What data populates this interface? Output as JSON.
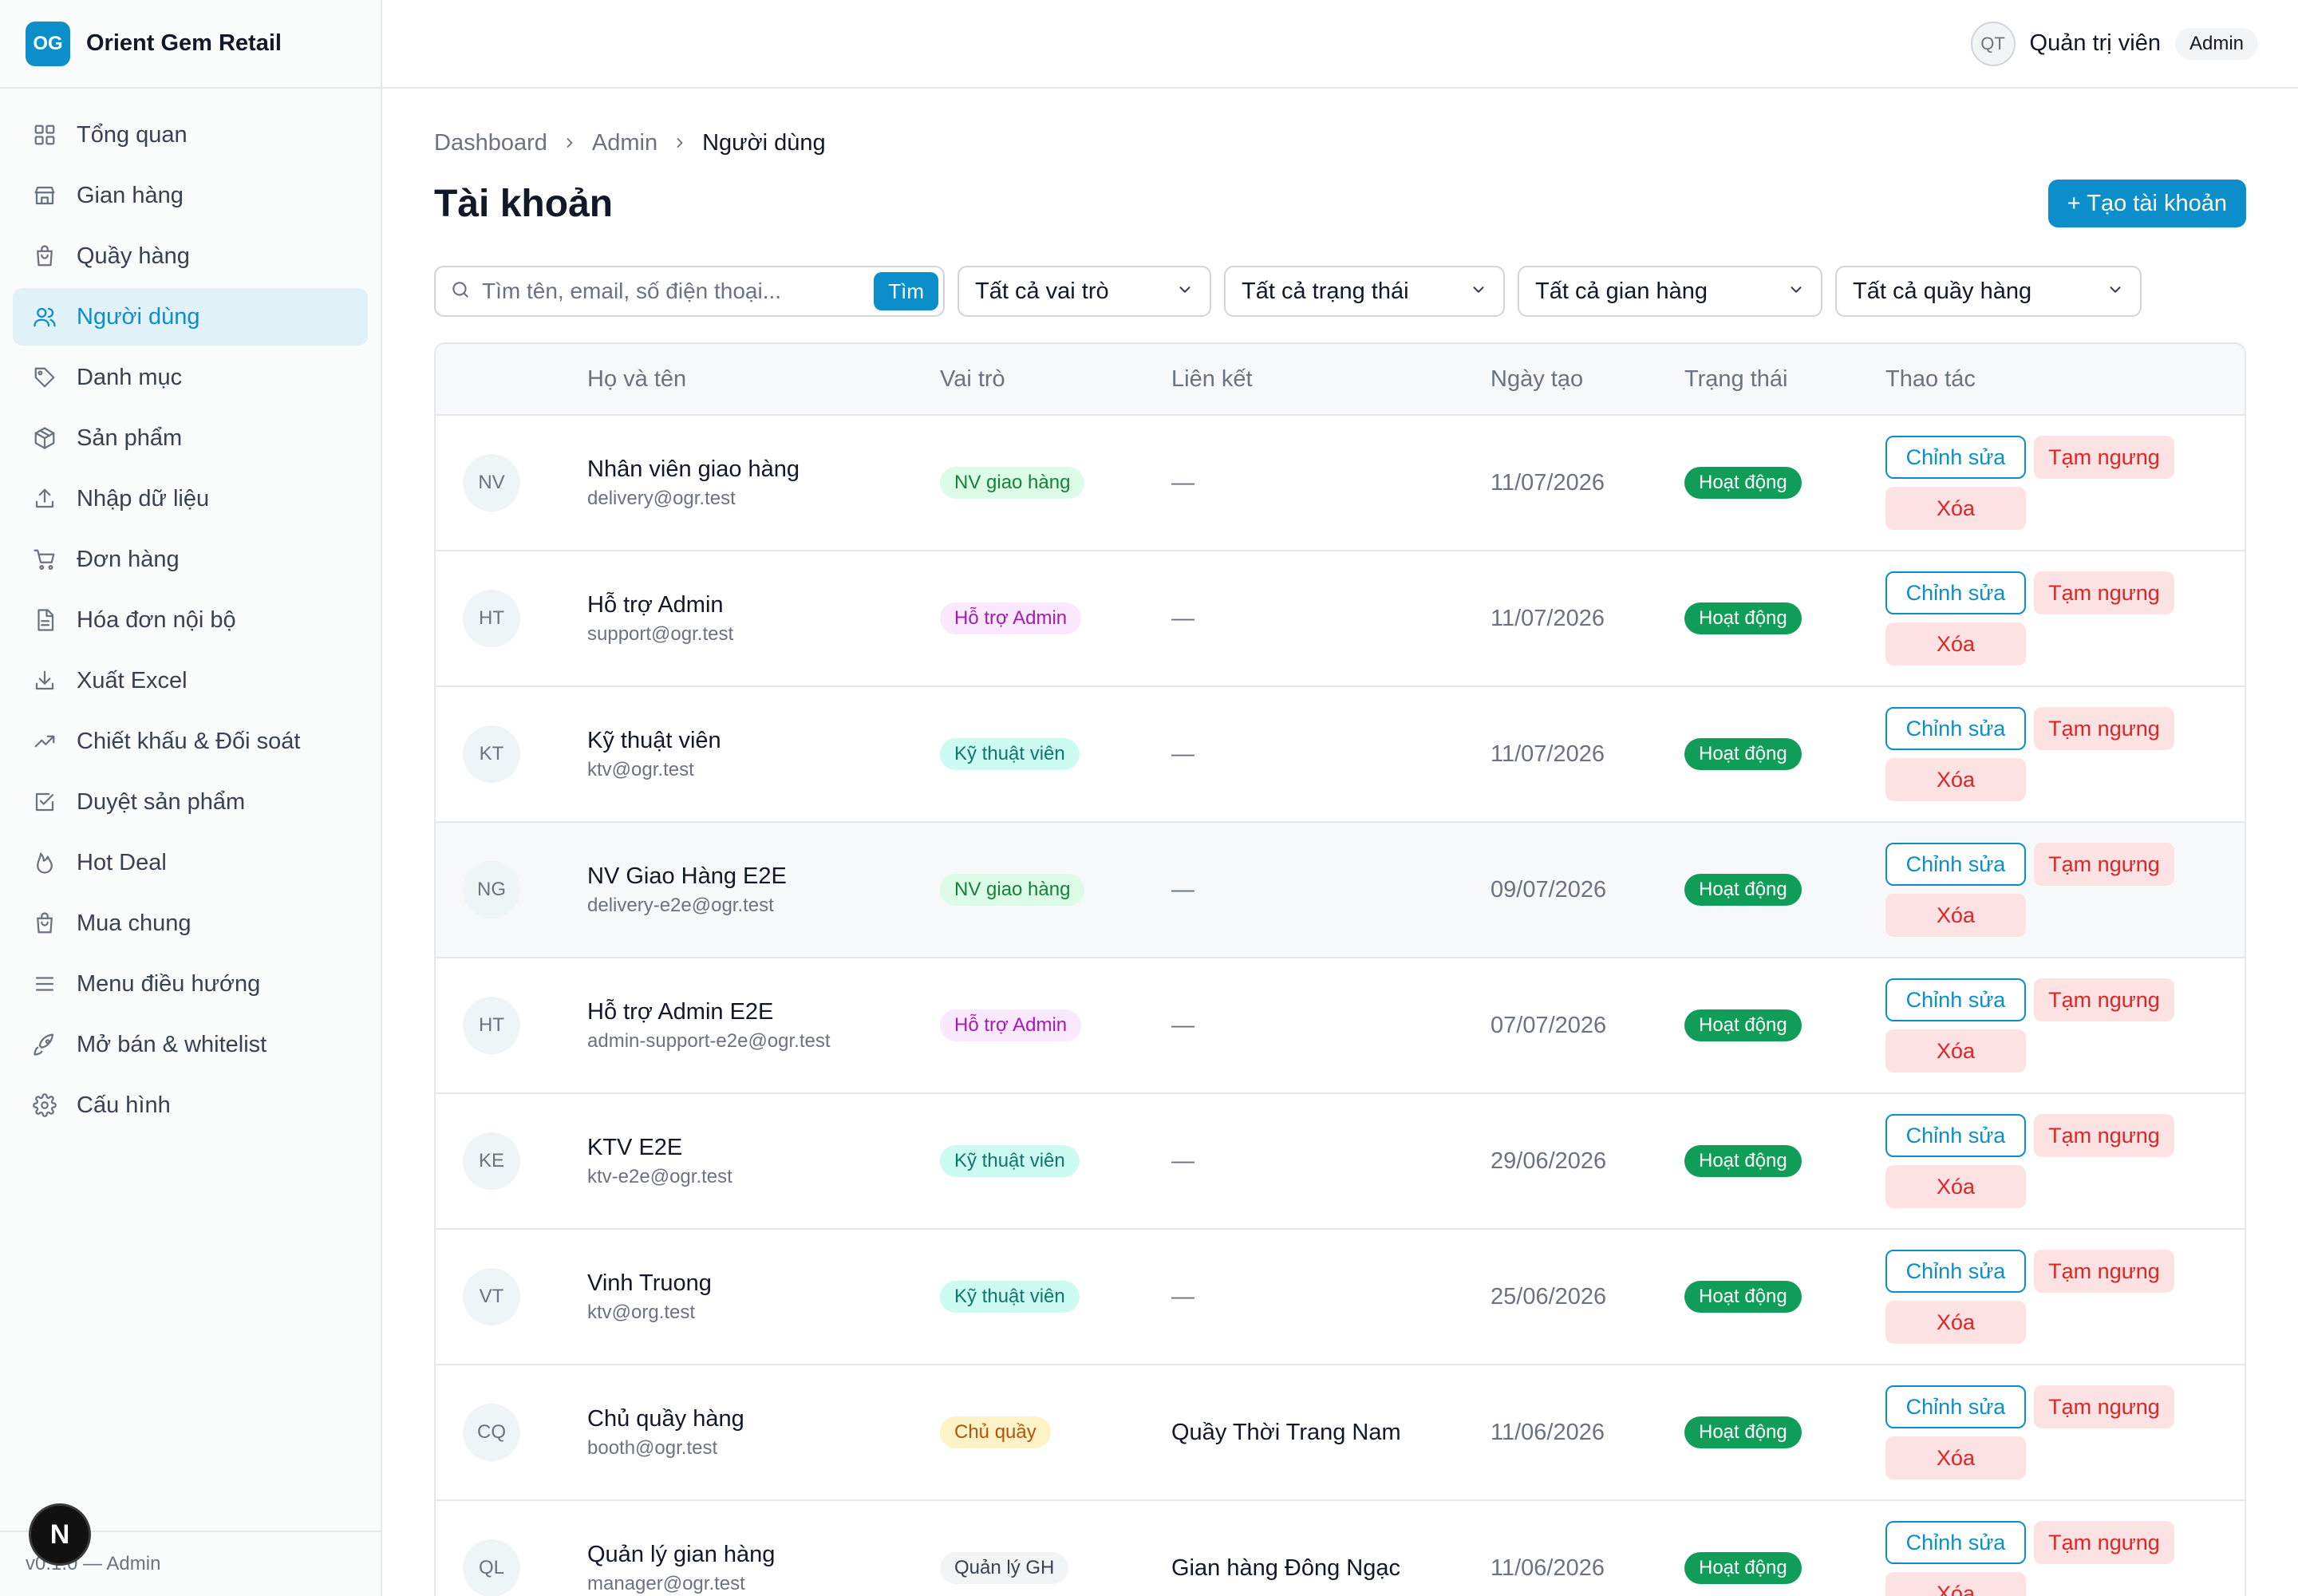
{
  "brand": {
    "logo": "OG",
    "name": "Orient Gem Retail"
  },
  "sidebar": {
    "items": [
      {
        "label": "Tổng quan",
        "icon": "grid-icon"
      },
      {
        "label": "Gian hàng",
        "icon": "store-icon"
      },
      {
        "label": "Quầy hàng",
        "icon": "bag-icon"
      },
      {
        "label": "Người dùng",
        "icon": "users-icon",
        "active": true
      },
      {
        "label": "Danh mục",
        "icon": "tag-icon"
      },
      {
        "label": "Sản phẩm",
        "icon": "package-icon"
      },
      {
        "label": "Nhập dữ liệu",
        "icon": "upload-icon"
      },
      {
        "label": "Đơn hàng",
        "icon": "cart-icon"
      },
      {
        "label": "Hóa đơn nội bộ",
        "icon": "document-icon"
      },
      {
        "label": "Xuất Excel",
        "icon": "download-icon"
      },
      {
        "label": "Chiết khấu & Đối soát",
        "icon": "trend-icon"
      },
      {
        "label": "Duyệt sản phẩm",
        "icon": "check-square-icon"
      },
      {
        "label": "Hot Deal",
        "icon": "flame-icon"
      },
      {
        "label": "Mua chung",
        "icon": "bag-icon"
      },
      {
        "label": "Menu điều hướng",
        "icon": "menu-icon"
      },
      {
        "label": "Mở bán & whitelist",
        "icon": "rocket-icon"
      },
      {
        "label": "Cấu hình",
        "icon": "gear-icon"
      }
    ],
    "footer": "v0.1.0 — Admin",
    "next_badge": "N"
  },
  "topbar": {
    "avatar": "QT",
    "user_name": "Quản trị viên",
    "role": "Admin"
  },
  "breadcrumb": {
    "items": [
      "Dashboard",
      "Admin"
    ],
    "current": "Người dùng"
  },
  "page": {
    "title": "Tài khoản",
    "create_label": "+ Tạo tài khoản"
  },
  "filters": {
    "search_placeholder": "Tìm tên, email, số điện thoại...",
    "search_button": "Tìm",
    "role": "Tất cả vai trò",
    "status": "Tất cả trạng thái",
    "store": "Tất cả gian hàng",
    "booth": "Tất cả quầy hàng"
  },
  "table": {
    "headers": [
      "Họ và tên",
      "Vai trò",
      "Liên kết",
      "Ngày tạo",
      "Trạng thái",
      "Thao tác"
    ],
    "actions": {
      "edit": "Chỉnh sửa",
      "pause": "Tạm ngưng",
      "delete": "Xóa"
    },
    "rows": [
      {
        "initials": "NV",
        "name": "Nhân viên giao hàng",
        "email": "delivery@ogr.test",
        "role": "NV giao hàng",
        "role_bg": "#dcfce7",
        "role_fg": "#15803d",
        "link": "—",
        "date": "11/07/2026",
        "status": "Hoạt động"
      },
      {
        "initials": "HT",
        "name": "Hỗ trợ Admin",
        "email": "support@ogr.test",
        "role": "Hỗ trợ Admin",
        "role_bg": "#fae8ff",
        "role_fg": "#a21caf",
        "link": "—",
        "date": "11/07/2026",
        "status": "Hoạt động"
      },
      {
        "initials": "KT",
        "name": "Kỹ thuật viên",
        "email": "ktv@ogr.test",
        "role": "Kỹ thuật viên",
        "role_bg": "#ccfbf1",
        "role_fg": "#0f766e",
        "link": "—",
        "date": "11/07/2026",
        "status": "Hoạt động"
      },
      {
        "initials": "NG",
        "name": "NV Giao Hàng E2E",
        "email": "delivery-e2e@ogr.test",
        "role": "NV giao hàng",
        "role_bg": "#dcfce7",
        "role_fg": "#15803d",
        "link": "—",
        "date": "09/07/2026",
        "status": "Hoạt động"
      },
      {
        "initials": "HT",
        "name": "Hỗ trợ Admin E2E",
        "email": "admin-support-e2e@ogr.test",
        "role": "Hỗ trợ Admin",
        "role_bg": "#fae8ff",
        "role_fg": "#a21caf",
        "link": "—",
        "date": "07/07/2026",
        "status": "Hoạt động"
      },
      {
        "initials": "KE",
        "name": "KTV E2E",
        "email": "ktv-e2e@ogr.test",
        "role": "Kỹ thuật viên",
        "role_bg": "#ccfbf1",
        "role_fg": "#0f766e",
        "link": "—",
        "date": "29/06/2026",
        "status": "Hoạt động"
      },
      {
        "initials": "VT",
        "name": "Vinh Truong",
        "email": "ktv@org.test",
        "role": "Kỹ thuật viên",
        "role_bg": "#ccfbf1",
        "role_fg": "#0f766e",
        "link": "—",
        "date": "25/06/2026",
        "status": "Hoạt động"
      },
      {
        "initials": "CQ",
        "name": "Chủ quầy hàng",
        "email": "booth@ogr.test",
        "role": "Chủ quầy",
        "role_bg": "#fef3c7",
        "role_fg": "#b45309",
        "link": "Quầy Thời Trang Nam",
        "date": "11/06/2026",
        "status": "Hoạt động"
      },
      {
        "initials": "QL",
        "name": "Quản lý gian hàng",
        "email": "manager@ogr.test",
        "role": "Quản lý GH",
        "role_bg": "#f3f4f6",
        "role_fg": "#374151",
        "link": "Gian hàng Đông Ngạc",
        "date": "11/06/2026",
        "status": "Hoạt động"
      }
    ]
  },
  "colors": {
    "accent": "#0b8ec9",
    "status_active": "#0f9d58",
    "danger": "#dc2626"
  }
}
